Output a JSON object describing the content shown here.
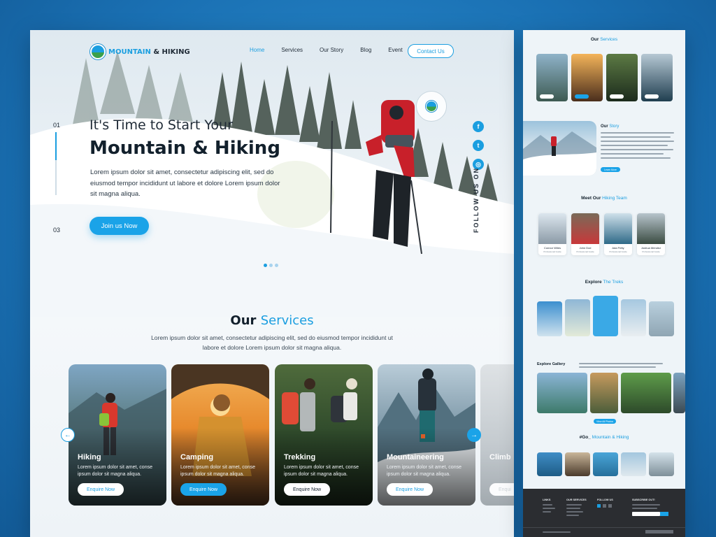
{
  "brand": {
    "name_a": "MOUNTAIN",
    "name_b": "& HIKING"
  },
  "nav": {
    "items": [
      "Home",
      "Services",
      "Our Story",
      "Blog",
      "Event"
    ],
    "contact_label": "Contact Us"
  },
  "hero": {
    "pager_current": "01",
    "pager_total": "03",
    "subtitle": "It's Time to Start Your",
    "title": "Mountain & Hiking",
    "description": "Lorem ipsum dolor sit amet, consectetur adipiscing elit, sed do eiusmod tempor incididunt ut labore et dolore Lorem ipsum dolor sit magna aliqua.",
    "cta_label": "Join us Now",
    "follow_label": "FOLLOW US ON",
    "social_icons": [
      "facebook-icon",
      "twitter-icon",
      "instagram-icon"
    ]
  },
  "services": {
    "title_a": "Our",
    "title_b": "Services",
    "description": "Lorem ipsum dolor sit amet, consectetur adipiscing elit, sed do eiusmod tempor incididunt ut labore et dolore Lorem ipsum dolor sit magna aliqua.",
    "cards": [
      {
        "name": "Hiking",
        "text": "Lorem ipsum dolor sit amet, conse ipsum dolor sit magna aliqua.",
        "button": "Enquire Now"
      },
      {
        "name": "Camping",
        "text": "Lorem ipsum dolor sit amet, conse ipsum dolor sit magna aliqua.",
        "button": "Enquire Now"
      },
      {
        "name": "Trekking",
        "text": "Lorem ipsum dolor sit amet, conse ipsum dolor sit magna aliqua.",
        "button": "Enquire Now"
      },
      {
        "name": "Mountaineering",
        "text": "Lorem ipsum dolor sit amet, conse ipsum dolor sit magna aliqua.",
        "button": "Enquire Now"
      },
      {
        "name": "Climb",
        "text": "",
        "button": "Enqui"
      }
    ]
  },
  "side": {
    "services_title_a": "Our",
    "services_title_b": "Services",
    "story_title_a": "Our",
    "story_title_b": "Story",
    "team_title_a": "Meet Our",
    "team_title_b": "Hiking Team",
    "team": [
      {
        "name": "Connor Wiles",
        "role": "Professional Guide"
      },
      {
        "name": "John Doe",
        "role": "Professional Guide"
      },
      {
        "name": "Ada Petty",
        "role": "Professional Guide"
      },
      {
        "name": "Joshua Mendez",
        "role": "Professional Guide"
      }
    ],
    "treks_title_a": "Explore",
    "treks_title_b": "The Treks",
    "gallery_title": "Explore Gallery",
    "gallery_button": "View All Photos",
    "hashtag_a": "#Go_",
    "hashtag_b": "Mountain & Hiking",
    "learn_more": "Learn More",
    "footer_cols": [
      "LINKS",
      "OUR SERVICES",
      "FOLLOW US",
      "SUBSCRIBE OUT!"
    ]
  }
}
